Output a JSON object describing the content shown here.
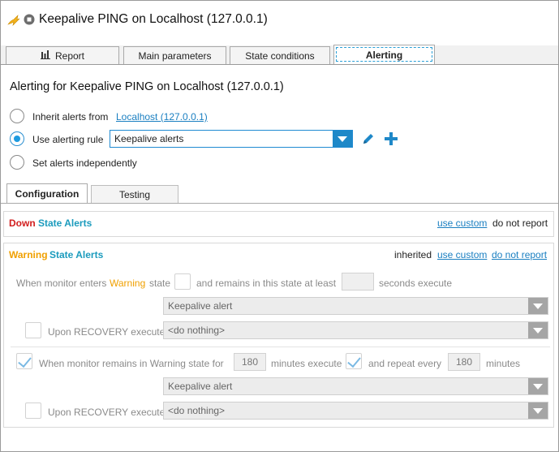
{
  "window": {
    "title": "Keepalive PING on Localhost (127.0.0.1)"
  },
  "tabs": [
    {
      "label": "Report",
      "icon": "bar-chart-icon"
    },
    {
      "label": "Main parameters"
    },
    {
      "label": "State conditions"
    },
    {
      "label": "Alerting",
      "active": true
    }
  ],
  "alerting": {
    "heading": "Alerting for Keepalive PING on Localhost (127.0.0.1)",
    "inherit_label": "Inherit alerts from",
    "inherit_link": "Localhost (127.0.0.1)",
    "use_rule_label": "Use alerting rule",
    "rule_value": "Keepalive alerts",
    "independent_label": "Set alerts independently",
    "selected_option": "use_rule"
  },
  "subtabs": [
    {
      "label": "Configuration",
      "active": true
    },
    {
      "label": "Testing"
    }
  ],
  "down": {
    "title_state": "Down",
    "title_rest": "State Alerts",
    "use_custom": "use custom",
    "do_not_report": "do not report"
  },
  "warning": {
    "title_state": "Warning",
    "title_rest": "State Alerts",
    "inherited": "inherited",
    "use_custom": "use custom",
    "do_not_report": "do not report",
    "enter_prefix": "When monitor enters",
    "enter_state": "Warning",
    "enter_suffix": "state",
    "remains_text": "and remains in this state at least",
    "seconds_value": "",
    "seconds_text": "seconds execute",
    "execute_action": "Keepalive alert",
    "recovery_label": "Upon RECOVERY execute",
    "recovery_action": "<do nothing>",
    "remain_label": "When monitor remains in Warning state for",
    "remain_minutes": "180",
    "minutes_execute": "minutes execute",
    "repeat_label": "and repeat every",
    "repeat_minutes": "180",
    "minutes": "minutes",
    "remain_action": "Keepalive alert",
    "recovery2_label": "Upon RECOVERY execute",
    "recovery2_action": "<do nothing>",
    "remain_checked": true,
    "repeat_checked": true,
    "enter_checked": false,
    "recovery_checked": false,
    "recovery2_checked": false
  },
  "colors": {
    "accent": "#1e88c8",
    "down": "#d21e1e",
    "warning": "#f0a000",
    "state_link": "#1b9bbd"
  }
}
